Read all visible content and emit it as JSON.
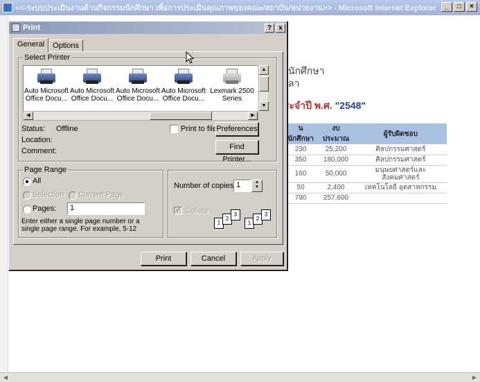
{
  "ie": {
    "title": "<<-ระบบประเมินงานด้านกิจกรรมนักศึกษา เพื่อการประเมินคุณภาพของคณะ/สถาบัน/หน่วยงาน>> - Microsoft Internet Explorer",
    "content": {
      "line1": "นักศึกษา",
      "line2": "ลา",
      "heading_prefix": "ระจำปี พ.ศ. ",
      "heading_year": "\"2548\"",
      "table": {
        "headers": [
          "นนักศึกษา",
          "งบประมาณ",
          "ผู้รับผิดชอบ"
        ],
        "rows": [
          [
            "230",
            "25,200",
            "ศิลปกรรมศาสตร์"
          ],
          [
            "350",
            "180,000",
            "ศิลปกรรมศาสตร์"
          ],
          [
            "160",
            "50,000",
            "มนุษยศาสตร์และ สังคมศาสตร์"
          ],
          [
            "50",
            "2,400",
            "เทคโนโลยี อุตสาหกรรม"
          ],
          [
            "790",
            "257,600",
            ""
          ]
        ]
      }
    }
  },
  "dialog": {
    "title": "Print",
    "help_btn": "?",
    "close_btn": "x",
    "tabs": [
      "General",
      "Options"
    ],
    "select_printer_label": "Select Printer",
    "printers": [
      {
        "line1": "Auto Microsoft",
        "line2": "Office Docu..."
      },
      {
        "line1": "Auto Microsoft",
        "line2": "Office Docu..."
      },
      {
        "line1": "Auto Microsoft",
        "line2": "Office Docu..."
      },
      {
        "line1": "Auto Microsoft",
        "line2": "Office Docu..."
      },
      {
        "line1": "Lexmark 2500",
        "line2": "Series"
      }
    ],
    "status_label": "Status:",
    "status_value": "Offline",
    "location_label": "Location:",
    "comment_label": "Comment:",
    "print_to_file": "Print to file",
    "preferences_btn": "Preferences",
    "find_printer_btn": "Find Printer...",
    "page_range": {
      "label": "Page Range",
      "all": "All",
      "selection": "Selection",
      "current_page": "Current Page",
      "pages": "Pages:",
      "pages_value": "1",
      "hint": "Enter either a single page number or a single page range.  For example, 5-12"
    },
    "copies": {
      "label": "Number of copies:",
      "value": "1",
      "collate": "Collate"
    },
    "buttons": {
      "print": "Print",
      "cancel": "Cancel",
      "apply": "Apply"
    }
  }
}
